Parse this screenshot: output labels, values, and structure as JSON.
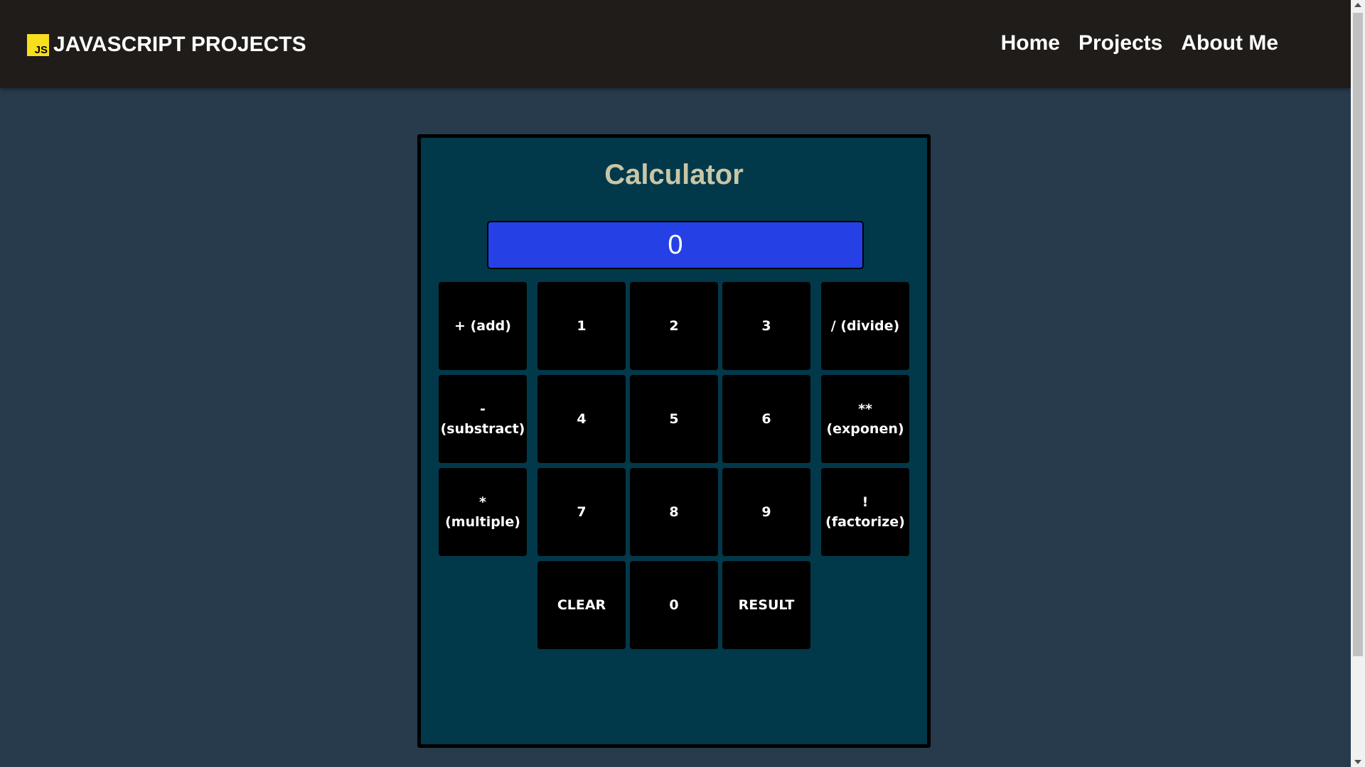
{
  "header": {
    "logo_text": "JS",
    "brand_title": "JAVASCRIPT PROJECTS",
    "nav": [
      "Home",
      "Projects",
      "About Me"
    ]
  },
  "calculator": {
    "title": "Calculator",
    "display_value": "0",
    "buttons": {
      "add": "+ (add)",
      "one": "1",
      "two": "2",
      "three": "3",
      "divide": "/ (divide)",
      "subtract": "- (substract)",
      "four": "4",
      "five": "5",
      "six": "6",
      "exponent": "** (exponen)",
      "multiply": "* (multiple)",
      "seven": "7",
      "eight": "8",
      "nine": "9",
      "factorize": "! (factorize)",
      "clear": "CLEAR",
      "zero": "0",
      "result": "RESULT"
    }
  },
  "colors": {
    "page_background": "#283b4d",
    "header_background": "#201c19",
    "calculator_background": "#02394a",
    "display_background": "#2541e6",
    "title_color": "#c9c6a7",
    "button_background": "#000000",
    "js_logo": "#f7df1e"
  }
}
